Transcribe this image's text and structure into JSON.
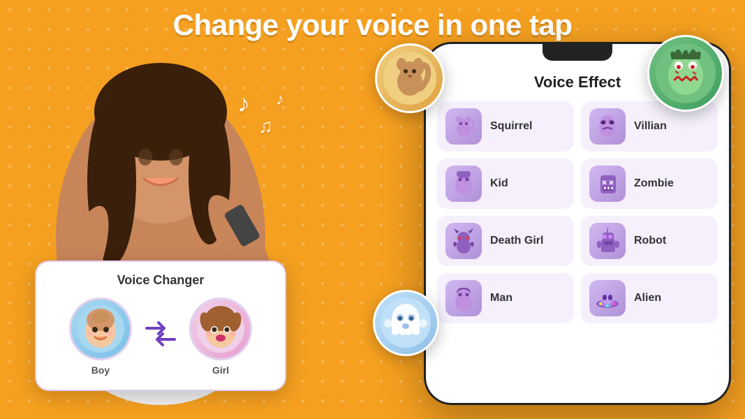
{
  "headline": "Change your voice in one tap",
  "voice_changer": {
    "title": "Voice Changer",
    "boy_label": "Boy",
    "girl_label": "Girl"
  },
  "phone": {
    "section_title": "Voice Effect",
    "effects": [
      {
        "name": "Squirrel",
        "emoji": "🐿️",
        "bg": "#e8d8f8"
      },
      {
        "name": "Villian",
        "emoji": "😈",
        "bg": "#e8d8f8"
      },
      {
        "name": "Kid",
        "emoji": "👦",
        "bg": "#e8d8f8"
      },
      {
        "name": "Zombie",
        "emoji": "🧟",
        "bg": "#e8d8f8"
      },
      {
        "name": "Death Girl",
        "emoji": "👾",
        "bg": "#e8d8f8"
      },
      {
        "name": "Robot",
        "emoji": "🤖",
        "bg": "#e8d8f8"
      },
      {
        "name": "Man",
        "emoji": "🧑",
        "bg": "#e8d8f8"
      },
      {
        "name": "Alien",
        "emoji": "👽",
        "bg": "#e8d8f8"
      }
    ]
  },
  "bubbles": {
    "squirrel_emoji": "🐿️",
    "zombie_emoji": "🧟",
    "ghost_emoji": "👻"
  },
  "music_notes": "♪♫♪",
  "colors": {
    "bg_orange": "#F5A020",
    "purple_accent": "#7040C0",
    "icon_purple_light": "#B090E0"
  }
}
